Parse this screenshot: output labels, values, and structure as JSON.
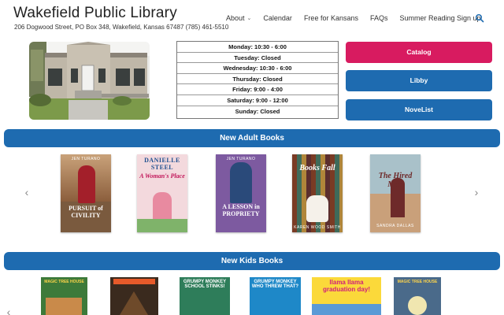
{
  "header": {
    "title": "Wakefield Public Library",
    "address": "206 Dogwood Street, PO Box 348, Wakefield, Kansas 67487 (785) 461-5510",
    "nav": [
      "About",
      "Calendar",
      "Free for Kansans",
      "FAQs",
      "Summer Reading Sign up"
    ],
    "search_icon": "search-icon",
    "accent": "#1e6bb0"
  },
  "hours": [
    "Monday: 10:30 - 6:00",
    "Tuesday: Closed",
    "Wednesday: 10:30 - 6:00",
    "Thursday: Closed",
    "Friday: 9:00 - 4:00",
    "Saturday: 9:00 - 12:00",
    "Sunday: Closed"
  ],
  "buttons": {
    "catalog": "Catalog",
    "libby": "Libby",
    "novelist": "NoveList",
    "catalog_color": "#d81b60",
    "primary_color": "#1e6bb0"
  },
  "sections": {
    "adult": "New Adult Books",
    "kids": "New Kids Books"
  },
  "adult_books": [
    {
      "author": "JEN TURANO",
      "title": "PURSUIT of CIVILITY"
    },
    {
      "author": "DANIELLE STEEL",
      "title": "A Woman's Place"
    },
    {
      "author": "JEN TURANO",
      "title": "A LESSON in PROPRIETY"
    },
    {
      "title": "Books Fall",
      "author": "KAREN WOOD SMITH"
    },
    {
      "title": "The Hired Man",
      "author": "SANDRA DALLAS"
    }
  ],
  "kids_books": [
    {
      "title": "MAGIC TREE HOUSE"
    },
    {
      "title": ""
    },
    {
      "title": "GRUMPY MONKEY SCHOOL STINKS!"
    },
    {
      "title": "GRUMPY MONKEY WHO THREW THAT?"
    },
    {
      "title": "llama llama graduation day!"
    },
    {
      "title": "MAGIC TREE HOUSE"
    }
  ]
}
